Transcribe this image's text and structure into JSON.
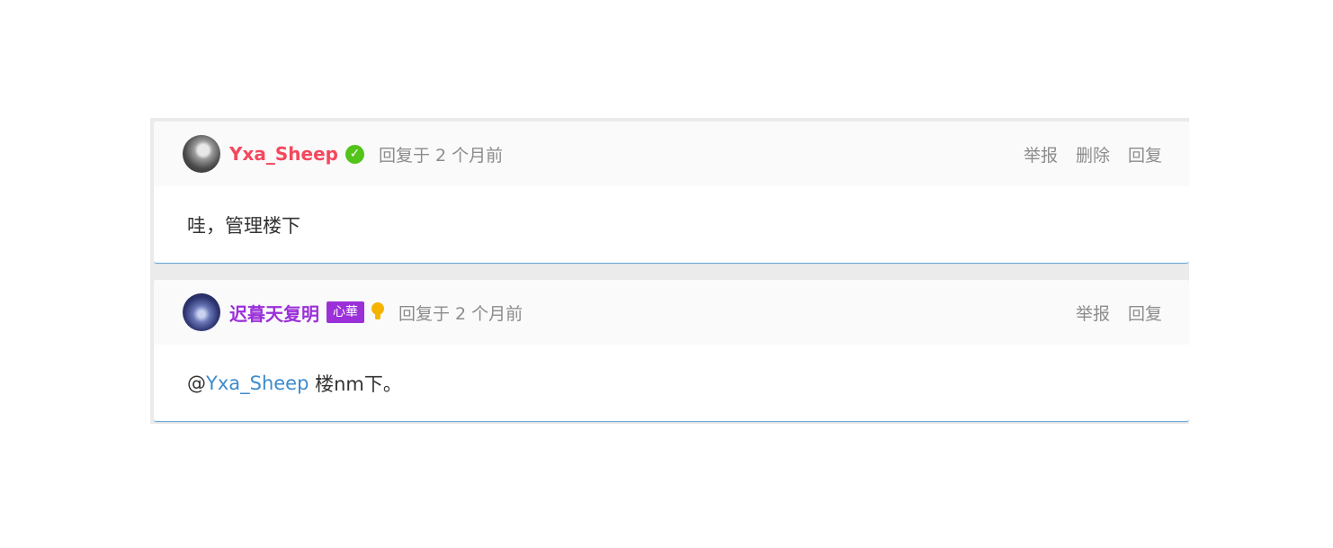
{
  "colors": {
    "user1_name": "#f5475c",
    "user2_name": "#9b30d9",
    "mention": "#3d8bcd",
    "verified": "#52c41a",
    "badge_bg": "#9b30d9",
    "muted": "#8c8c8c"
  },
  "comments": [
    {
      "username": "Yxa_Sheep",
      "time": "回复于 2 个月前",
      "verified_icon": "check-circle",
      "actions": {
        "report": "举报",
        "delete": "删除",
        "reply": "回复"
      },
      "content": "哇，管理楼下"
    },
    {
      "username": "迟暮天复明",
      "badge": "心華",
      "badge_icon": "lightbulb",
      "time": "回复于 2 个月前",
      "actions": {
        "report": "举报",
        "reply": "回复"
      },
      "content": {
        "prefix": "@",
        "mention": "Yxa_Sheep",
        "text": " 楼nm下。"
      }
    }
  ]
}
